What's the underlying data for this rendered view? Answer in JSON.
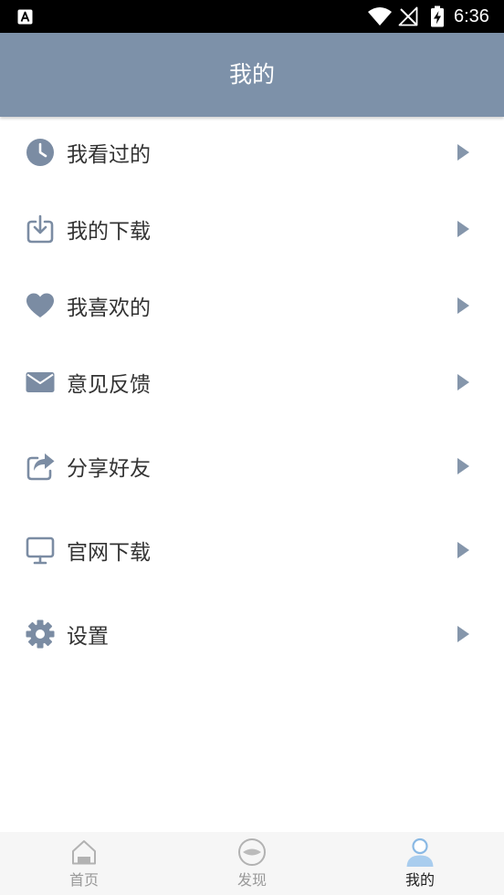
{
  "status_bar": {
    "time": "6:36",
    "icons": [
      "notification-icon",
      "wifi-icon",
      "no-signal-icon",
      "battery-charging-icon"
    ]
  },
  "header": {
    "title": "我的"
  },
  "menu": {
    "items": [
      {
        "label": "我看过的",
        "icon": "clock-icon"
      },
      {
        "label": "我的下载",
        "icon": "download-icon"
      },
      {
        "label": "我喜欢的",
        "icon": "heart-icon"
      },
      {
        "label": "意见反馈",
        "icon": "mail-icon"
      },
      {
        "label": "分享好友",
        "icon": "share-icon"
      },
      {
        "label": "官网下载",
        "icon": "monitor-icon"
      },
      {
        "label": "设置",
        "icon": "gear-icon"
      }
    ],
    "arrow_icon": "chevron-right-icon"
  },
  "bottom_nav": {
    "tabs": [
      {
        "label": "首页",
        "icon": "home-icon",
        "active": false
      },
      {
        "label": "发现",
        "icon": "discover-icon",
        "active": false
      },
      {
        "label": "我的",
        "icon": "profile-icon",
        "active": true
      }
    ]
  },
  "colors": {
    "header_bg": "#7d91a9",
    "icon": "#7b8ca3",
    "text": "#333333",
    "active_tab_icon": "#8ab9e4",
    "inactive_tab": "#999999",
    "active_tab_label": "#222222"
  }
}
